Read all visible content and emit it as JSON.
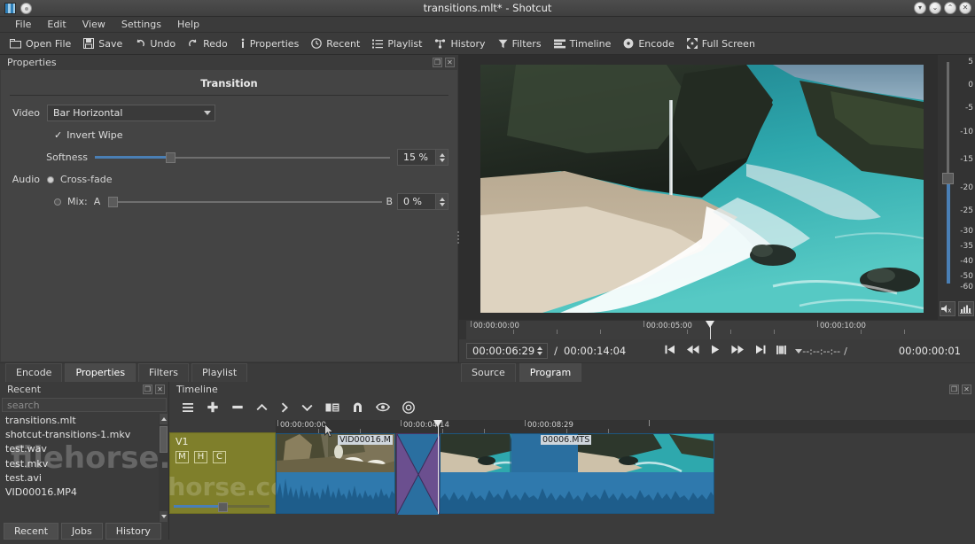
{
  "window": {
    "title": "transitions.mlt* - Shotcut",
    "buttons": [
      "shade",
      "minimize",
      "maximize",
      "close"
    ]
  },
  "menubar": {
    "items": [
      "File",
      "Edit",
      "View",
      "Settings",
      "Help"
    ]
  },
  "toolbar": {
    "items": [
      {
        "label": "Open File",
        "icon": "folder-icon"
      },
      {
        "label": "Save",
        "icon": "save-icon"
      },
      {
        "label": "Undo",
        "icon": "undo-icon"
      },
      {
        "label": "Redo",
        "icon": "redo-icon"
      },
      {
        "label": "Properties",
        "icon": "info-icon"
      },
      {
        "label": "Recent",
        "icon": "clock-icon"
      },
      {
        "label": "Playlist",
        "icon": "list-icon"
      },
      {
        "label": "History",
        "icon": "history-icon"
      },
      {
        "label": "Filters",
        "icon": "funnel-icon"
      },
      {
        "label": "Timeline",
        "icon": "timeline-icon"
      },
      {
        "label": "Encode",
        "icon": "record-icon"
      },
      {
        "label": "Full Screen",
        "icon": "fullscreen-icon"
      }
    ]
  },
  "properties": {
    "panel_title": "Properties",
    "heading": "Transition",
    "video_label": "Video",
    "video_value": "Bar Horizontal",
    "invert_wipe_label": "Invert Wipe",
    "invert_wipe_checked": true,
    "softness_label": "Softness",
    "softness_value": "15 %",
    "softness_percent": 15,
    "audio_label": "Audio",
    "crossfade_label": "Cross-fade",
    "crossfade_selected": true,
    "mix_label": "Mix:",
    "mix_selected": false,
    "mix_a_label": "A",
    "mix_b_label": "B",
    "mix_value": "0 %",
    "mix_percent": 0
  },
  "player": {
    "scrub_labels": [
      "00:00:00:00",
      "00:00:05:00",
      "00:00:10:00"
    ],
    "position": "00:00:06:29",
    "separator": "/",
    "duration": "00:00:14:04",
    "selected_duration": "--:--:--:--",
    "in_point": "00:00:00:01",
    "transport_buttons": [
      "skip-to-start-icon",
      "rewind-icon",
      "play-icon",
      "fast-forward-icon",
      "skip-to-end-icon",
      "stop-icon",
      "dropdown-icon"
    ],
    "tabs": [
      {
        "label": "Source",
        "active": false
      },
      {
        "label": "Program",
        "active": true
      }
    ]
  },
  "audio_meter": {
    "scale": [
      "5",
      "0",
      "-5",
      "-10",
      "-15",
      "-20",
      "-25",
      "-30",
      "-35",
      "-40",
      "-50",
      "-60"
    ],
    "level_db": -16,
    "buttons": [
      "mute-icon",
      "audio-settings-icon"
    ]
  },
  "left_tabs": [
    {
      "label": "Encode",
      "active": false
    },
    {
      "label": "Properties",
      "active": true
    },
    {
      "label": "Filters",
      "active": false
    },
    {
      "label": "Playlist",
      "active": false
    }
  ],
  "recent": {
    "panel_title": "Recent",
    "search_placeholder": "search",
    "items": [
      "transitions.mlt",
      "shotcut-transitions-1.mkv",
      "test.wav",
      "test.mkv",
      "test.avi",
      "VID00016.MP4"
    ],
    "tabs": [
      {
        "label": "Recent",
        "active": true
      },
      {
        "label": "Jobs",
        "active": false
      },
      {
        "label": "History",
        "active": false
      }
    ]
  },
  "timeline": {
    "panel_title": "Timeline",
    "toolbar_icons": [
      "menu-icon",
      "append-icon",
      "ripple-delete-icon",
      "lift-icon",
      "overwrite-icon",
      "split-icon",
      "properties-icon",
      "snap-magnet-icon",
      "scrub-while-dragging-icon",
      "marker-icon"
    ],
    "ruler_labels": [
      "00:00:00:00",
      "00:00:04:14",
      "00:00:08:29"
    ],
    "track": {
      "name": "V1",
      "buttons": [
        "M",
        "H",
        "C"
      ]
    },
    "clips": [
      {
        "label": "VID00016.M",
        "type": "video"
      },
      {
        "label": "",
        "type": "transition"
      },
      {
        "label": "00006.MTS",
        "type": "video"
      }
    ]
  },
  "watermark": {
    "text": "filehorse.com"
  },
  "colors": {
    "accent": "#4a7fb5",
    "track_header": "#7f7f2b",
    "clip": "#2a6fa0",
    "transition": "#6b4f8f",
    "panel_bg": "#3b3b3b"
  }
}
